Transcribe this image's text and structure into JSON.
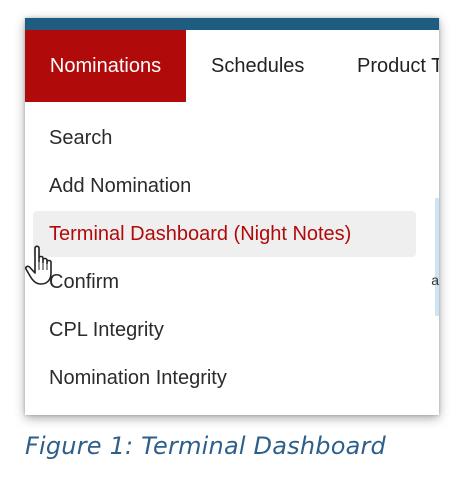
{
  "nav": {
    "tabs": [
      {
        "label": "Nominations",
        "active": true
      },
      {
        "label": "Schedules",
        "active": false
      },
      {
        "label": "Product T",
        "active": false
      }
    ]
  },
  "dropdown": {
    "items": [
      {
        "label": "Search"
      },
      {
        "label": "Add Nomination"
      },
      {
        "label": "Terminal Dashboard (Night Notes)",
        "highlighted": true
      },
      {
        "label": "Confirm"
      },
      {
        "label": "CPL Integrity"
      },
      {
        "label": "Nomination Integrity"
      }
    ]
  },
  "peek": {
    "letter": "a"
  },
  "caption": {
    "text": "Figure 1: Terminal Dashboard"
  },
  "colors": {
    "accent_red": "#b10a0a",
    "topbar_blue": "#1f5c82",
    "caption_blue": "#2e5f8a",
    "hover_gray": "#efefef"
  },
  "icons": {
    "pointer": "hand-pointer-icon"
  }
}
